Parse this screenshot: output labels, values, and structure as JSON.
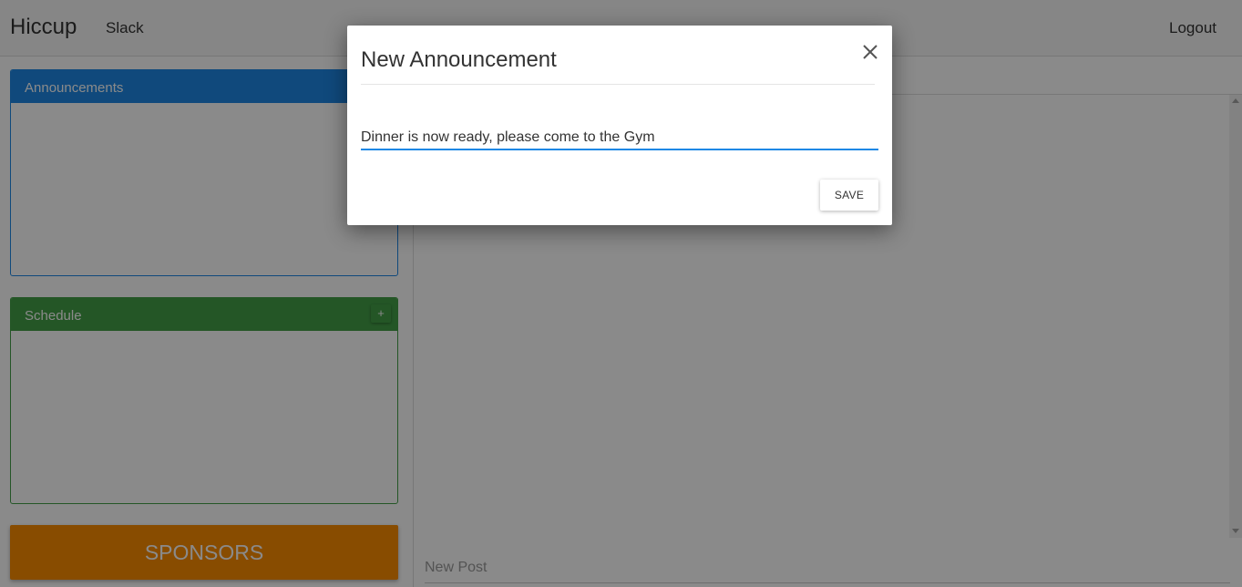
{
  "navbar": {
    "brand": "Hiccup",
    "slack_link": "Slack",
    "logout_link": "Logout"
  },
  "sidebar": {
    "announcements_title": "Announcements",
    "schedule_title": "Schedule",
    "schedule_add_label": "+",
    "sponsors_label": "SPONSORS"
  },
  "feed": {
    "new_post_placeholder": "New Post"
  },
  "modal": {
    "title": "New Announcement",
    "input_value": "Dinner is now ready, please come to the Gym",
    "save_label": "SAVE"
  },
  "colors": {
    "announcements": "#1e88e5",
    "schedule": "#43a047",
    "sponsors": "#fb8c00",
    "overlay": "rgba(0,0,0,0.46)"
  },
  "icons": [
    "close-icon",
    "plus-icon",
    "scroll-up-icon",
    "scroll-down-icon"
  ]
}
